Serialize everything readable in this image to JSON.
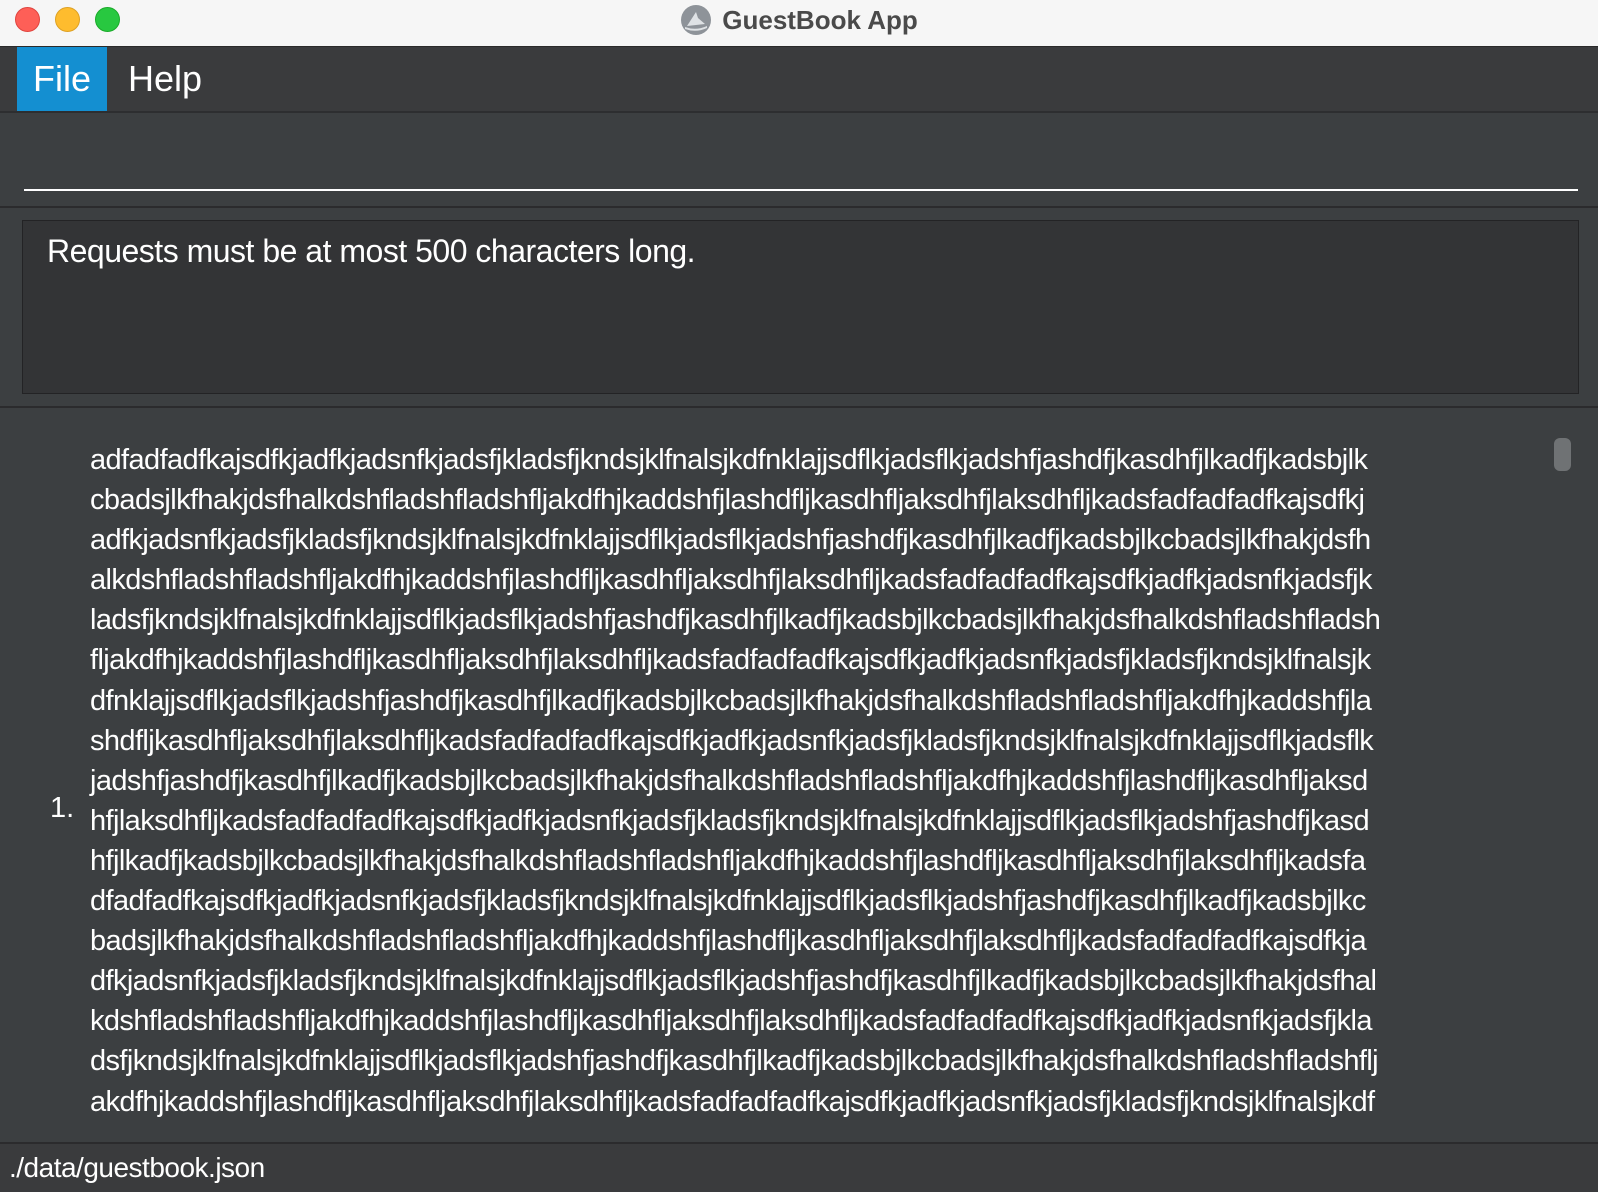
{
  "window": {
    "title": "GuestBook App"
  },
  "menu": {
    "items": [
      {
        "label": "File"
      },
      {
        "label": "Help"
      }
    ]
  },
  "command": {
    "value": "",
    "placeholder": ""
  },
  "result": {
    "message": "Requests must be at most 500 characters long."
  },
  "list": {
    "items": [
      {
        "index": "1.",
        "lines": [
          "adfadfadfkajsdfkjadfkjadsnfkjadsfjkladsfjkndsjklfnalsjkdfnklajjsdflkjadsflkjadshfjashdfjkasdhfjlkadfjkadsbjlk",
          "cbadsjlkfhakjdsfhalkdshfladshfladshfljakdfhjkaddshfjlashdfljkasdhfljaksdhfjlaksdhfljkadsfadfadfadfkajsdfkj",
          "adfkjadsnfkjadsfjkladsfjkndsjklfnalsjkdfnklajjsdflkjadsflkjadshfjashdfjkasdhfjlkadfjkadsbjlkcbadsjlkfhakjdsfh",
          "alkdshfladshfladshfljakdfhjkaddshfjlashdfljkasdhfljaksdhfjlaksdhfljkadsfadfadfadfkajsdfkjadfkjadsnfkjadsfjk",
          "ladsfjkndsjklfnalsjkdfnklajjsdflkjadsflkjadshfjashdfjkasdhfjlkadfjkadsbjlkcbadsjlkfhakjdsfhalkdshfladshfladsh",
          "fljakdfhjkaddshfjlashdfljkasdhfljaksdhfjlaksdhfljkadsfadfadfadfkajsdfkjadfkjadsnfkjadsfjkladsfjkndsjklfnalsjk",
          "dfnklajjsdflkjadsflkjadshfjashdfjkasdhfjlkadfjkadsbjlkcbadsjlkfhakjdsfhalkdshfladshfladshfljakdfhjkaddshfjla",
          "shdfljkasdhfljaksdhfjlaksdhfljkadsfadfadfadfkajsdfkjadfkjadsnfkjadsfjkladsfjkndsjklfnalsjkdfnklajjsdflkjadsflk",
          "jadshfjashdfjkasdhfjlkadfjkadsbjlkcbadsjlkfhakjdsfhalkdshfladshfladshfljakdfhjkaddshfjlashdfljkasdhfljaksd",
          "hfjlaksdhfljkadsfadfadfadfkajsdfkjadfkjadsnfkjadsfjkladsfjkndsjklfnalsjkdfnklajjsdflkjadsflkjadshfjashdfjkasd",
          "hfjlkadfjkadsbjlkcbadsjlkfhakjdsfhalkdshfladshfladshfljakdfhjkaddshfjlashdfljkasdhfljaksdhfjlaksdhfljkadsfa",
          "dfadfadfkajsdfkjadfkjadsnfkjadsfjkladsfjkndsjklfnalsjkdfnklajjsdflkjadsflkjadshfjashdfjkasdhfjlkadfjkadsbjlkc",
          "badsjlkfhakjdsfhalkdshfladshfladshfljakdfhjkaddshfjlashdfljkasdhfljaksdhfjlaksdhfljkadsfadfadfadfkajsdfkja",
          "dfkjadsnfkjadsfjkladsfjkndsjklfnalsjkdfnklajjsdflkjadsflkjadshfjashdfjkasdhfjlkadfjkadsbjlkcbadsjlkfhakjdsfhal",
          "kdshfladshfladshfljakdfhjkaddshfjlashdfljkasdhfljaksdhfjlaksdhfljkadsfadfadfadfkajsdfkjadfkjadsnfkjadsfjkla",
          "dsfjkndsjklfnalsjkdfnklajjsdflkjadsflkjadshfjashdfjkasdhfjlkadfjkadsbjlkcbadsjlkfhakjdsfhalkdshfladshfladshflj",
          "akdfhjkaddshfjlashdfljkasdhfljaksdhfjlaksdhfljkadsfadfadfadfkajsdfkjadfkjadsnfkjadsfjkladsfjkndsjklfnalsjkdf"
        ]
      }
    ]
  },
  "status": {
    "path": "./data/guestbook.json"
  },
  "colors": {
    "accent": "#148fd1",
    "background": "#3c3f41",
    "text": "#ffffff"
  }
}
